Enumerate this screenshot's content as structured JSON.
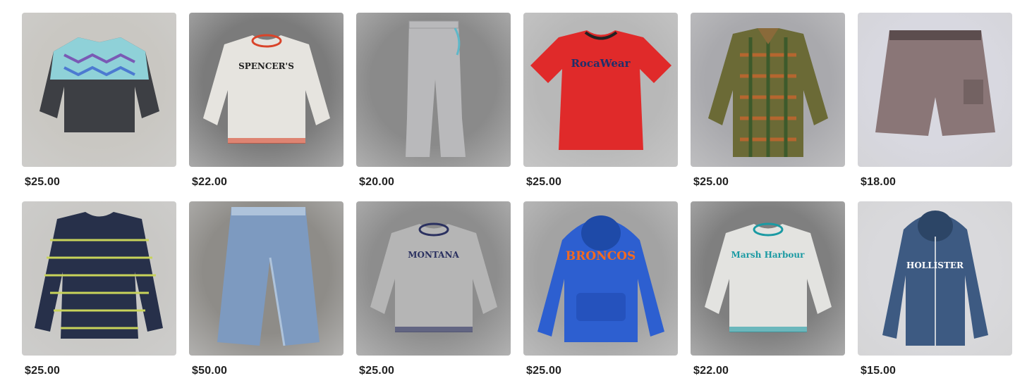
{
  "listings": [
    {
      "price": "$25.00",
      "item_icon": "quarter-zip-fleece-icon",
      "background": "#c9c7c2",
      "garment_color": "#3d3f44",
      "accent_color": "#8fd1d8"
    },
    {
      "price": "$22.00",
      "item_icon": "crewneck-sweatshirt-icon",
      "background": "#7b7b7b",
      "garment_color": "#e6e4df",
      "accent_color": "#d9442a",
      "print_text": "SPENCER'S"
    },
    {
      "price": "$20.00",
      "item_icon": "sweatpants-icon",
      "background": "#8a8a8a",
      "garment_color": "#b9b9bb",
      "accent_color": "#5fb8c9"
    },
    {
      "price": "$25.00",
      "item_icon": "tshirt-icon",
      "background": "#b8b8b8",
      "garment_color": "#e02a2a",
      "accent_color": "#f2c84b",
      "print_text": "RocaWear"
    },
    {
      "price": "$25.00",
      "item_icon": "flannel-jacket-icon",
      "background": "#a9a9ad",
      "garment_color": "#6b6a36",
      "accent_color": "#b5662f"
    },
    {
      "price": "$18.00",
      "item_icon": "cargo-shorts-icon",
      "background": "#d8d8e0",
      "garment_color": "#8a7677",
      "accent_color": "#5c4d4e"
    },
    {
      "price": "$25.00",
      "item_icon": "striped-sweater-icon",
      "background": "#c9c8c5",
      "garment_color": "#27304a",
      "accent_color": "#c8d35a"
    },
    {
      "price": "$50.00",
      "item_icon": "jeans-icon",
      "background": "#8e8c88",
      "garment_color": "#7d9ac0",
      "accent_color": "#aec3db"
    },
    {
      "price": "$25.00",
      "item_icon": "crewneck-sweatshirt-icon",
      "background": "#8d8d8d",
      "garment_color": "#b5b5b5",
      "accent_color": "#2b3160",
      "print_text": "MONTANA"
    },
    {
      "price": "$25.00",
      "item_icon": "hoodie-icon",
      "background": "#a3a3a3",
      "garment_color": "#2d5fd0",
      "accent_color": "#f26a21",
      "print_text": "BRONCOS"
    },
    {
      "price": "$22.00",
      "item_icon": "crewneck-sweatshirt-icon",
      "background": "#7f7f7f",
      "garment_color": "#e3e3e0",
      "accent_color": "#1b9aa3",
      "print_text": "Marsh Harbour"
    },
    {
      "price": "$15.00",
      "item_icon": "zip-hoodie-icon",
      "background": "#d9d9dc",
      "garment_color": "#3d5a82",
      "accent_color": "#ffffff",
      "print_text": "HOLLISTER"
    }
  ]
}
